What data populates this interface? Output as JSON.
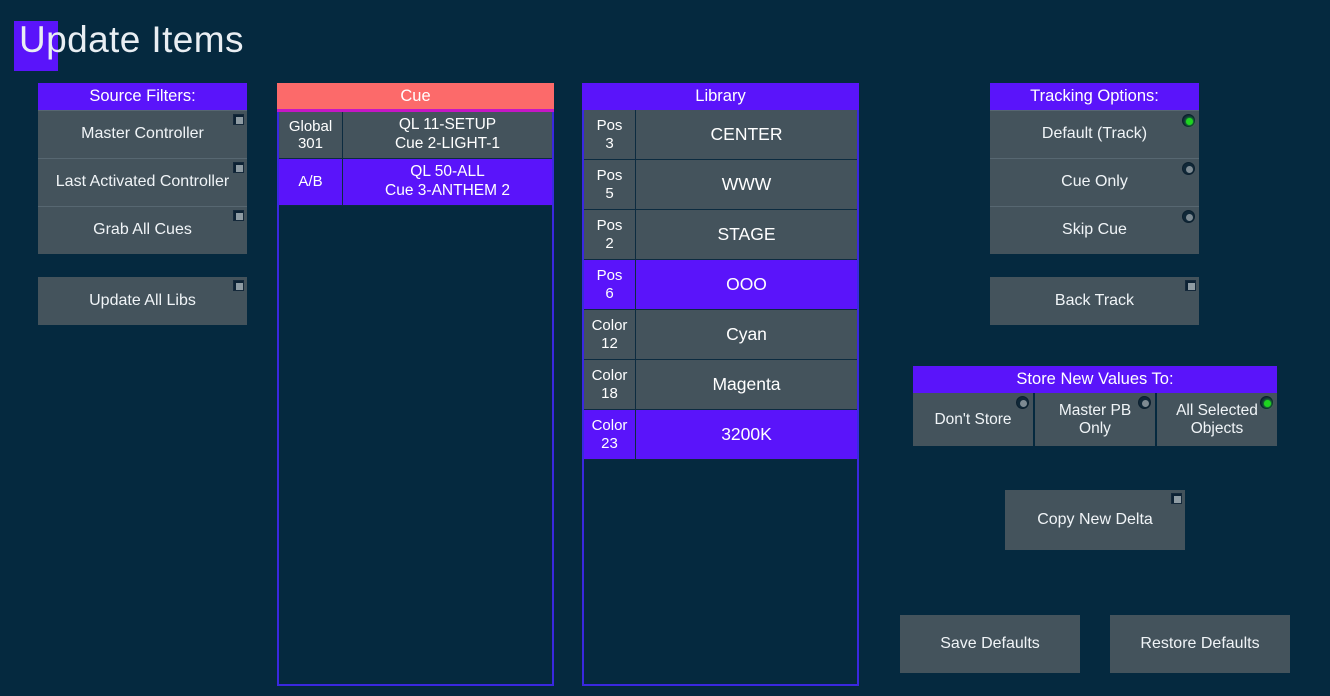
{
  "window": {
    "title": "Update Items",
    "background_color": "#05293f",
    "accent_purple": "#5a14fa",
    "accent_red": "#fc6a6a",
    "button_fill": "#44535c",
    "active_dot_color": "#1ed420"
  },
  "source_filters": {
    "header": "Source Filters:",
    "buttons": [
      {
        "label": "Master Controller",
        "indicator": "checkbox",
        "checked": false
      },
      {
        "label": "Last Activated Controller",
        "indicator": "checkbox",
        "checked": false
      },
      {
        "label": "Grab All Cues",
        "indicator": "checkbox",
        "checked": false
      }
    ],
    "update_all": {
      "label": "Update All Libs",
      "indicator": "checkbox",
      "checked": false
    }
  },
  "cue": {
    "header": "Cue",
    "rows": [
      {
        "tag": "Global 301",
        "tag_line1": "Global",
        "tag_line2": "301",
        "line1": "QL 11-SETUP",
        "line2": "Cue 2-LIGHT-1",
        "selected": false
      },
      {
        "tag": "A/B",
        "tag_line1": "A/B",
        "tag_line2": "",
        "line1": "QL 50-ALL",
        "line2": "Cue 3-ANTHEM 2",
        "selected": true
      }
    ]
  },
  "library": {
    "header": "Library",
    "rows": [
      {
        "type": "Pos",
        "index": "3",
        "value": "CENTER",
        "selected": false
      },
      {
        "type": "Pos",
        "index": "5",
        "value": "WWW",
        "selected": false
      },
      {
        "type": "Pos",
        "index": "2",
        "value": "STAGE",
        "selected": false
      },
      {
        "type": "Pos",
        "index": "6",
        "value": "OOO",
        "selected": true
      },
      {
        "type": "Color",
        "index": "12",
        "value": "Cyan",
        "selected": false
      },
      {
        "type": "Color",
        "index": "18",
        "value": "Magenta",
        "selected": false
      },
      {
        "type": "Color",
        "index": "23",
        "value": "3200K",
        "selected": true
      }
    ]
  },
  "tracking_options": {
    "header": "Tracking Options:",
    "buttons": [
      {
        "label": "Default (Track)",
        "indicator": "radio",
        "active": true
      },
      {
        "label": "Cue Only",
        "indicator": "radio",
        "active": false
      },
      {
        "label": "Skip Cue",
        "indicator": "radio",
        "active": false
      }
    ],
    "back_track": {
      "label": "Back Track",
      "indicator": "checkbox",
      "checked": false
    }
  },
  "store_new_values": {
    "header": "Store New Values To:",
    "buttons": [
      {
        "label": "Don't Store",
        "indicator": "radio",
        "active": false
      },
      {
        "label": "Master PB Only",
        "line1": "Master PB",
        "line2": "Only",
        "indicator": "radio",
        "active": false
      },
      {
        "label": "All Selected Objects",
        "line1": "All Selected",
        "line2": "Objects",
        "indicator": "radio",
        "active": true
      }
    ]
  },
  "copy_new_delta": {
    "label": "Copy New Delta",
    "indicator": "checkbox",
    "checked": false
  },
  "footer": {
    "save_defaults": "Save Defaults",
    "restore_defaults": "Restore Defaults"
  }
}
